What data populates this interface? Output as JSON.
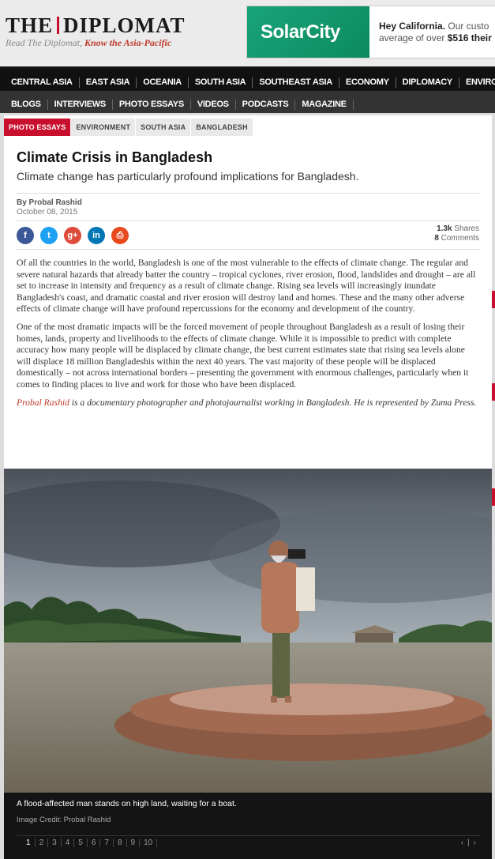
{
  "header": {
    "logo_left": "THE",
    "logo_right": "DIPLOMAT",
    "tagline_plain": "Read The Diplomat, ",
    "tagline_bold": "Know the Asia-Pacific"
  },
  "ad": {
    "brand": "SolarCity",
    "line1_bold": "Hey California.",
    "line1": " Our custo",
    "line2": "average of over ",
    "line2_bold": "$516 their"
  },
  "nav_primary": [
    "CENTRAL ASIA",
    "EAST ASIA",
    "OCEANIA",
    "SOUTH ASIA",
    "SOUTHEAST ASIA",
    "ECONOMY",
    "DIPLOMACY",
    "ENVIRONM"
  ],
  "nav_secondary": [
    "BLOGS",
    "INTERVIEWS",
    "PHOTO ESSAYS",
    "VIDEOS",
    "PODCASTS",
    "MAGAZINE"
  ],
  "tags": [
    "PHOTO ESSAYS",
    "ENVIRONMENT",
    "SOUTH ASIA",
    "BANGLADESH"
  ],
  "article": {
    "title": "Climate Crisis in Bangladesh",
    "subtitle": "Climate change has particularly profound implications for Bangladesh.",
    "byline": "By Probal Rashid",
    "date": "October 08, 2015",
    "shares_count": "1.3k",
    "shares_label": " Shares",
    "comments_count": "8",
    "comments_label": " Comments",
    "para1": "Of all the countries in the world, Bangladesh is one of the most vulnerable to the effects of climate change. The regular and severe natural hazards that already batter the country – tropical cyclones, river erosion, flood, landslides and drought – are all set to increase in intensity and frequency as a result of climate change. Rising sea levels will increasingly inundate Bangladesh's coast, and dramatic coastal and river erosion will destroy land and homes. These and the many other adverse effects of climate change will have profound repercussions for the economy and development of the country.",
    "para2": "One of the most dramatic impacts will be the forced movement of people throughout Bangladesh as a result of losing their homes, lands, property and livelihoods to the effects of climate change. While it is impossible to predict with complete accuracy how many people will be displaced by climate change, the best current estimates state that rising sea levels alone will displace 18 million Bangladeshis within the next 40 years. The vast majority of these people will be displaced domestically – not across international borders – presenting the government with enormous challenges, particularly when it comes to finding places to live and work for those who have been displaced.",
    "bio_author": "Probal Rashid",
    "bio_rest": " is a documentary photographer and photojournalist working in Bangladesh. He is represented by Zuma Press."
  },
  "share_icons": [
    {
      "name": "facebook-icon",
      "glyph": "f",
      "color": "#3b5998"
    },
    {
      "name": "twitter-icon",
      "glyph": "t",
      "color": "#1da1f2"
    },
    {
      "name": "google-plus-icon",
      "glyph": "g+",
      "color": "#dd4b39"
    },
    {
      "name": "linkedin-icon",
      "glyph": "in",
      "color": "#0077b5"
    },
    {
      "name": "print-icon",
      "glyph": "⎙",
      "color": "#e8491d"
    }
  ],
  "gallery": {
    "caption": "A flood-affected man stands on high land, waiting for a boat.",
    "credit": "Image Credit: Probal Rashid",
    "pages": [
      "1",
      "2",
      "3",
      "4",
      "5",
      "6",
      "7",
      "8",
      "9",
      "10"
    ],
    "current_page": "1",
    "prev": "‹",
    "next": "›"
  }
}
